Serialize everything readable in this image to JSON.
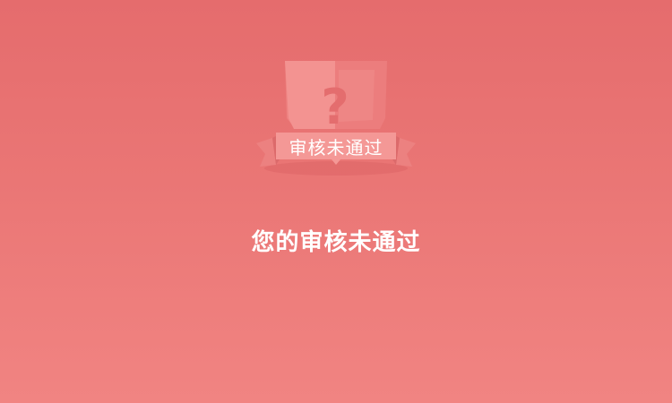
{
  "badge": {
    "label": "审核未通过",
    "icon": "question-mark-icon"
  },
  "message": "您的审核未通过",
  "colors": {
    "background_top": "#e56c6d",
    "background_bottom": "#f18482",
    "badge_card": "#f08e8c",
    "badge_ribbon": "#f49896",
    "text": "#ffffff"
  }
}
